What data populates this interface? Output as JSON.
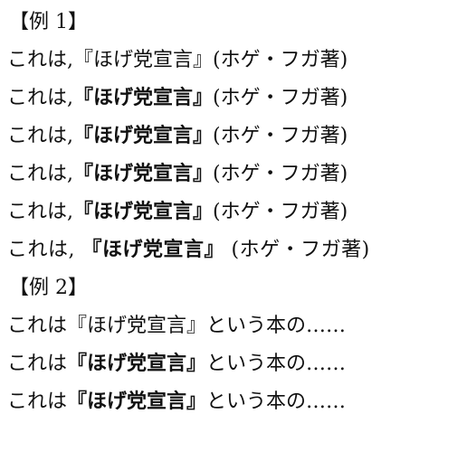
{
  "example1": {
    "heading": "【例 1】",
    "lines": [
      {
        "pre": "これは,",
        "mid": "『ほげ党宣言』",
        "post": "(ホゲ・フガ著)"
      },
      {
        "pre": "これは,",
        "mid": "『ほげ党宣言』",
        "post": "(ホゲ・フガ著)"
      },
      {
        "pre": "これは,",
        "mid": "『ほげ党宣言』",
        "post": "(ホゲ・フガ著)"
      },
      {
        "pre": "これは,",
        "mid": "『ほげ党宣言』",
        "post": "(ホゲ・フガ著)"
      },
      {
        "pre": "これは,",
        "mid": "『ほげ党宣言』",
        "post": "(ホゲ・フガ著)"
      },
      {
        "pre": "これは,",
        "mid": "『ほげ党宣言』",
        "post": "(ホゲ・フガ著)"
      }
    ]
  },
  "example2": {
    "heading": "【例 2】",
    "lines": [
      {
        "pre": "これは",
        "mid": "『ほげ党宣言』",
        "post": "という本の……"
      },
      {
        "pre": "これは",
        "mid": "『ほげ党宣言』",
        "post": "という本の……"
      },
      {
        "pre": "これは",
        "mid": "『ほげ党宣言』",
        "post": "という本の……"
      }
    ]
  }
}
